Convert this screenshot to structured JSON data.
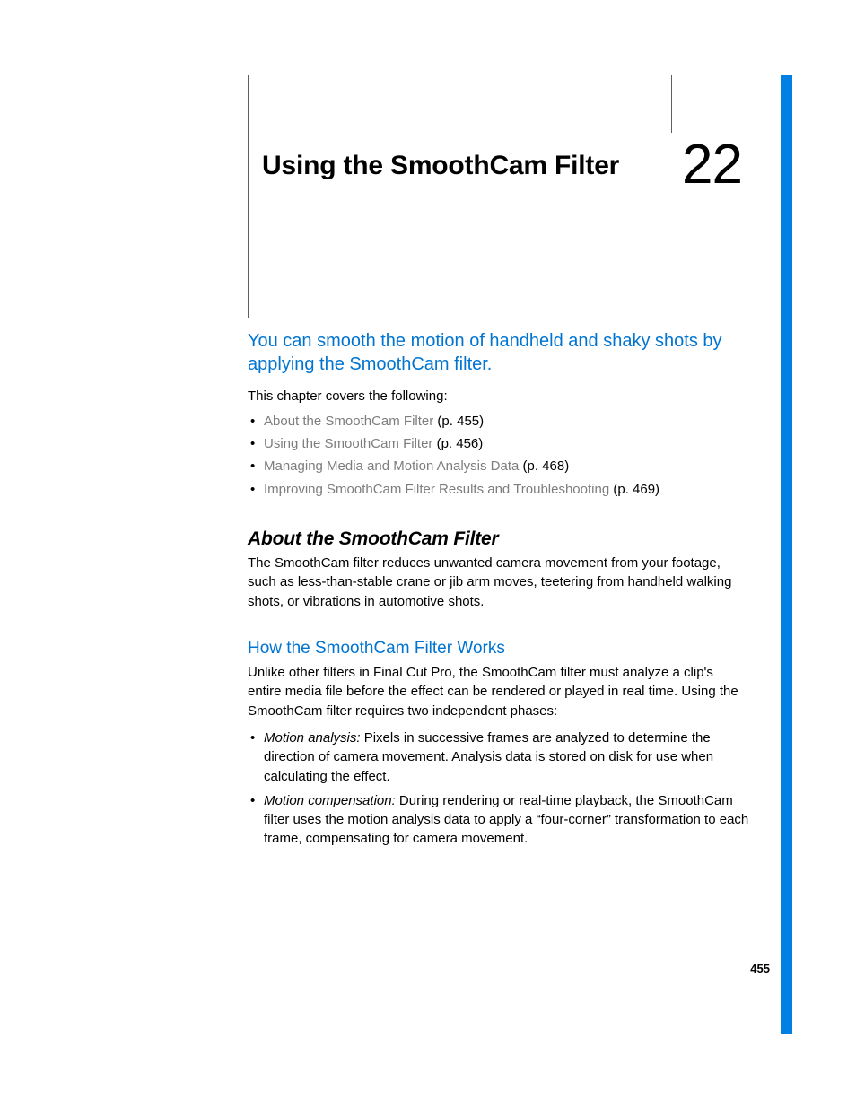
{
  "chapter": {
    "title": "Using the SmoothCam Filter",
    "number": "22"
  },
  "summary": "You can smooth the motion of handheld and shaky shots by applying the SmoothCam filter.",
  "intro_line": "This chapter covers the following:",
  "toc": [
    {
      "label": "About the SmoothCam Filter",
      "page_ref": " (p. 455)"
    },
    {
      "label": "Using the SmoothCam Filter",
      "page_ref": " (p. 456)"
    },
    {
      "label": "Managing Media and Motion Analysis Data",
      "page_ref": " (p. 468)"
    },
    {
      "label": "Improving SmoothCam Filter Results and Troubleshooting",
      "page_ref": " (p. 469)"
    }
  ],
  "about": {
    "heading": "About the SmoothCam Filter",
    "body": "The SmoothCam filter reduces unwanted camera movement from your footage, such as less-than-stable crane or jib arm moves, teetering from handheld walking shots, or vibrations in automotive shots."
  },
  "how": {
    "heading": "How the SmoothCam Filter Works",
    "body": "Unlike other filters in Final Cut Pro, the SmoothCam filter must analyze a clip's entire media file before the effect can be rendered or played in real time. Using the SmoothCam filter requires two independent phases:",
    "phases": [
      {
        "term": "Motion analysis:  ",
        "desc": "Pixels in successive frames are analyzed to determine the direction of camera movement. Analysis data is stored on disk for use when calculating the effect."
      },
      {
        "term": "Motion compensation:  ",
        "desc": "During rendering or real-time playback, the SmoothCam filter uses the motion analysis data to apply a “four-corner” transformation to each frame, compensating for camera movement."
      }
    ]
  },
  "page_number": "455"
}
